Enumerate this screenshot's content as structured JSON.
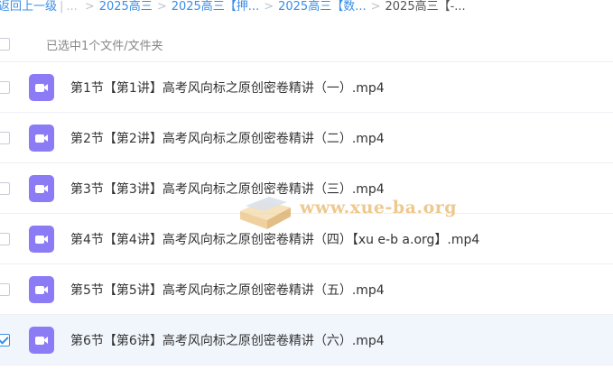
{
  "breadcrumb": {
    "back_label": "返回上一级",
    "separator_bar": "|",
    "ellipsis": "...",
    "items": [
      "2025高三",
      "2025高三【押...",
      "2025高三【数...",
      "2025高三【-..."
    ]
  },
  "list_header": {
    "selection_text": "已选中1个文件/文件夹",
    "select_all_checked": false
  },
  "files": [
    {
      "name": "第1节【第1讲】高考风向标之原创密卷精讲（一）.mp4",
      "checked": false,
      "icon": "video-file-icon"
    },
    {
      "name": "第2节【第2讲】高考风向标之原创密卷精讲（二）.mp4",
      "checked": false,
      "icon": "video-file-icon"
    },
    {
      "name": "第3节【第3讲】高考风向标之原创密卷精讲（三）.mp4",
      "checked": false,
      "icon": "video-file-icon"
    },
    {
      "name": "第4节【第4讲】高考风向标之原创密卷精讲（四）【xu e-b a.org】.mp4",
      "checked": false,
      "icon": "video-file-icon"
    },
    {
      "name": "第5节【第5讲】高考风向标之原创密卷精讲（五）.mp4",
      "checked": false,
      "icon": "video-file-icon"
    },
    {
      "name": "第6节【第6讲】高考风向标之原创密卷精讲（六）.mp4",
      "checked": true,
      "icon": "video-file-icon"
    }
  ],
  "watermark": {
    "text": "www.xue-ba.org"
  },
  "colors": {
    "accent": "#3a8ee6",
    "video_icon": "#8b7cf6",
    "selected_row": "#f1f6fd"
  }
}
